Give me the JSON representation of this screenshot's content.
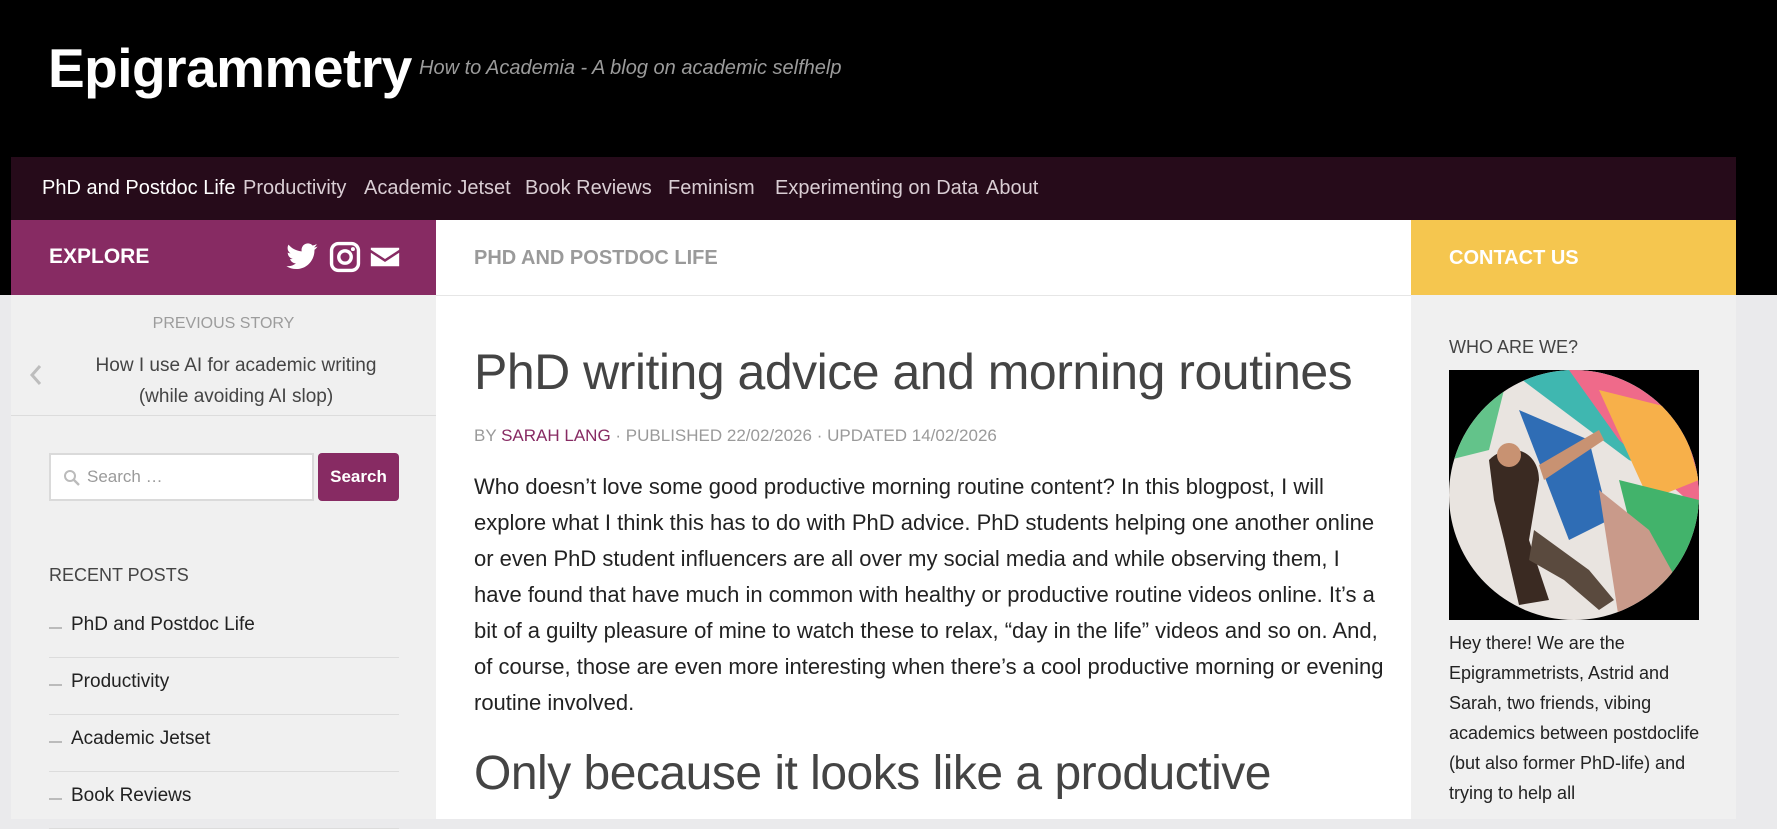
{
  "site": {
    "title": "Epigrammetry",
    "tagline": "How to Academia - A blog on academic selfhelp"
  },
  "nav": {
    "items": [
      {
        "label": "PhD and Postdoc Life",
        "active": true
      },
      {
        "label": "Productivity"
      },
      {
        "label": "Academic Jetset"
      },
      {
        "label": "Book Reviews"
      },
      {
        "label": "Feminism"
      },
      {
        "label": "Experimenting on Data"
      },
      {
        "label": "About"
      }
    ]
  },
  "explore": {
    "label": "EXPLORE",
    "icons": [
      "twitter-icon",
      "instagram-icon",
      "mail-icon"
    ]
  },
  "content_header": {
    "section": "PHD AND POSTDOC LIFE"
  },
  "contact": {
    "label": "CONTACT US"
  },
  "previous_story": {
    "heading": "PREVIOUS STORY",
    "line1": "How I use AI for academic writing",
    "line2": "(while avoiding AI slop)"
  },
  "search": {
    "placeholder": "Search …",
    "button": "Search"
  },
  "recent_posts": {
    "title": "RECENT POSTS",
    "items": [
      "PhD and Postdoc Life",
      "Productivity",
      "Academic Jetset",
      "Book Reviews"
    ]
  },
  "post": {
    "title": "PhD writing advice and morning routines",
    "meta_by": "BY ",
    "author": "SARAH LANG",
    "meta_rest": " · PUBLISHED 22/02/2026 · UPDATED 14/02/2026",
    "body": "Who doesn’t love some good productive morning routine content? In this blogpost, I will explore what I think this has to do with PhD advice. PhD students helping one another online or even PhD student influencers are all over my social media and while observing them, I have found that have much in common with healthy or productive routine videos online. It’s a bit of a guilty pleasure of mine to watch these to relax, “day in the life” videos and so on. And, of course, those are even more interesting when there’s a cool productive morning or evening routine involved.",
    "subheading": "Only because it looks like a productive"
  },
  "sidebar_right": {
    "title": "WHO ARE WE?",
    "bio": "Hey there! We are the Epigrammetrists, Astrid and Sarah, two friends, vibing academics between postdoclife (but also former PhD-life) and trying to help all"
  },
  "colors": {
    "accent": "#872b63",
    "nav_bg": "#260b1a",
    "contact": "#f5c64f"
  }
}
